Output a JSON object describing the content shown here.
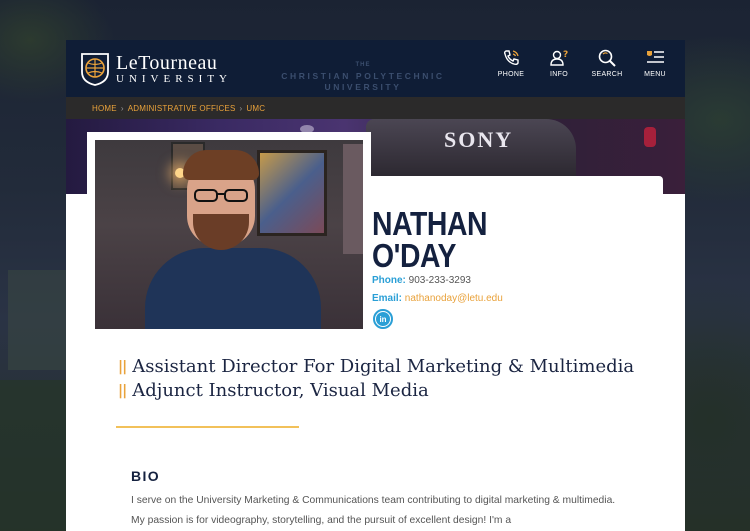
{
  "brand": {
    "name": "LeTourneau",
    "sub": "UNIVERSITY",
    "tagline_the": "THE",
    "tagline": "CHRISTIAN POLYTECHNIC UNIVERSITY"
  },
  "nav": [
    {
      "label": "PHONE",
      "icon": "phone-icon"
    },
    {
      "label": "INFO",
      "icon": "info-user-icon"
    },
    {
      "label": "SEARCH",
      "icon": "search-icon"
    },
    {
      "label": "MENU",
      "icon": "menu-icon"
    }
  ],
  "breadcrumb": [
    "HOME",
    "ADMINISTRATIVE OFFICES",
    "UMC"
  ],
  "hero": {
    "brand_text": "SONY"
  },
  "profile": {
    "first_name": "NATHAN",
    "last_name": "O'DAY",
    "phone_label": "Phone:",
    "phone": "903-233-3293",
    "email_label": "Email:",
    "email": "nathanoday@letu.edu",
    "linkedin": "in",
    "titles": [
      "Assistant Director For Digital Marketing & Multimedia",
      "Adjunct Instructor, Visual Media"
    ],
    "title_marker": "||",
    "bio_heading": "BIO",
    "bio_text": "I serve on the University Marketing & Communications team contributing to digital marketing & multimedia. My passion is for videography, storytelling, and the pursuit of excellent design! I'm a"
  },
  "colors": {
    "navy": "#0f1d36",
    "gold": "#e9a23b",
    "blue": "#2a9fd6",
    "text_dark": "#14213f"
  }
}
